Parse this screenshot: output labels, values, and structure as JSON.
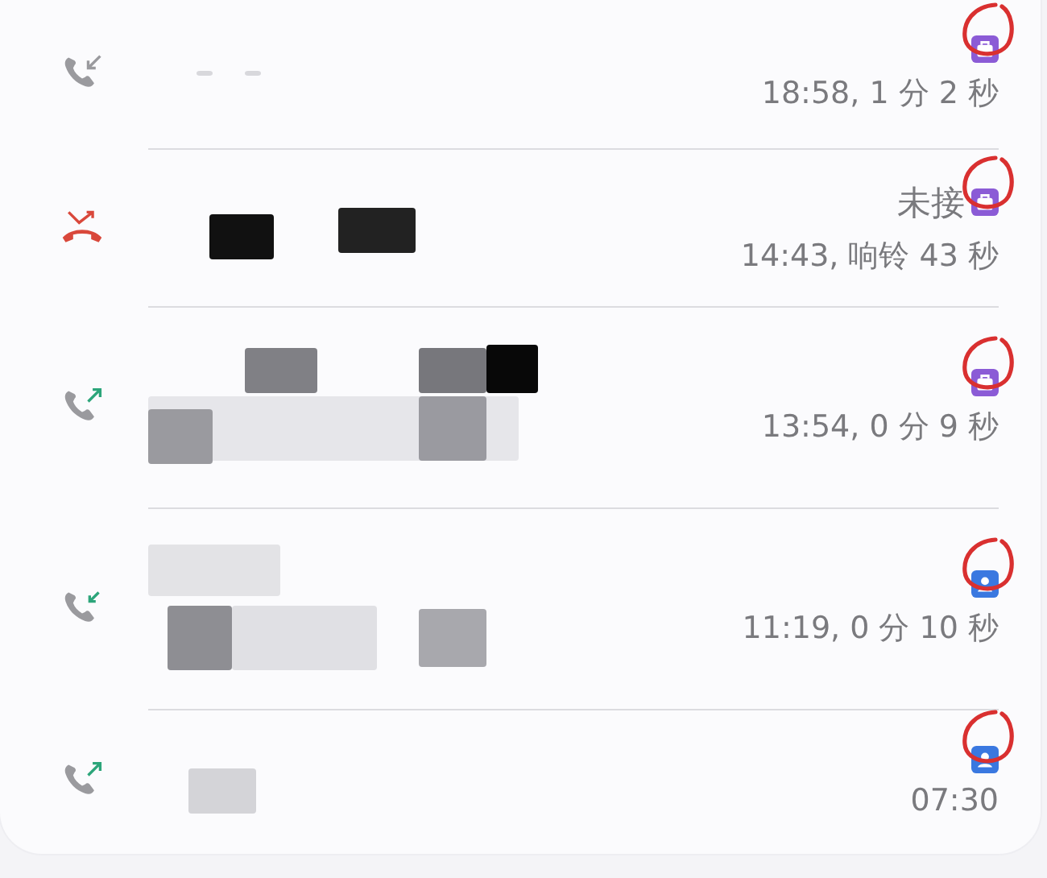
{
  "calls": [
    {
      "kind": "incoming",
      "time": "18:58, 1 分 2 秒",
      "profile": {
        "kind": "work"
      },
      "circled": true
    },
    {
      "kind": "missed",
      "status": "未接",
      "time": "14:43, 响铃 43 秒",
      "profile": {
        "kind": "work"
      },
      "circled": true
    },
    {
      "kind": "outgoing",
      "time": "13:54, 0 分 9 秒",
      "profile": {
        "kind": "work"
      },
      "circled": true
    },
    {
      "kind": "incoming-ok",
      "time": "11:19, 0 分 10 秒",
      "profile": {
        "kind": "personal"
      },
      "circled": true
    },
    {
      "kind": "outgoing",
      "time": "07:30",
      "profile": {
        "kind": "personal"
      },
      "circled": true
    }
  ]
}
